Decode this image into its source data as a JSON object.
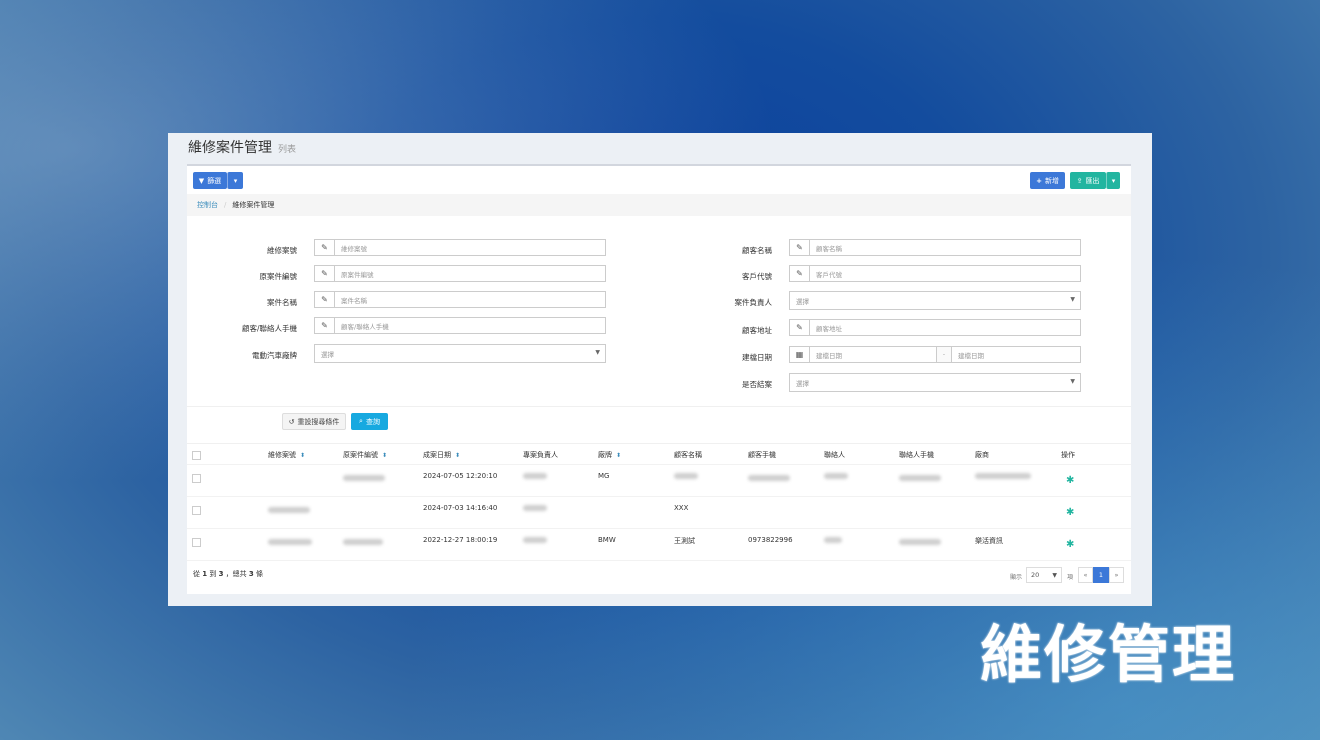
{
  "page": {
    "title": "維修案件管理",
    "subtitle": "列表"
  },
  "toolbar": {
    "filter_label": "篩選",
    "add_label": "新增",
    "export_label": "匯出"
  },
  "breadcrumb": {
    "home": "控制台",
    "current": "維修案件管理"
  },
  "form": {
    "left": [
      {
        "label": "維修案號",
        "placeholder": "維修案號",
        "icon": "pencil-icon"
      },
      {
        "label": "原案件編號",
        "placeholder": "原案件編號",
        "icon": "pencil-icon"
      },
      {
        "label": "案件名稱",
        "placeholder": "案件名稱",
        "icon": "pencil-icon"
      },
      {
        "label": "顧客/聯絡人手機",
        "placeholder": "顧客/聯絡人手機",
        "icon": "pencil-icon"
      },
      {
        "label": "電動汽車廠牌",
        "select": "選擇"
      }
    ],
    "right": [
      {
        "label": "顧客名稱",
        "placeholder": "顧客名稱",
        "icon": "pencil-icon"
      },
      {
        "label": "客戶代號",
        "placeholder": "客戶代號",
        "icon": "pencil-icon"
      },
      {
        "label": "案件負責人",
        "select": "選擇"
      },
      {
        "label": "顧客地址",
        "placeholder": "顧客地址",
        "icon": "pencil-icon"
      },
      {
        "label": "建檔日期",
        "date_from": "建檔日期",
        "date_sep": "-",
        "date_to": "建檔日期",
        "icon": "calendar-icon"
      },
      {
        "label": "是否結案",
        "select": "選擇"
      }
    ],
    "reset_label": "重設搜尋條件",
    "search_label": "查詢"
  },
  "table": {
    "headers": [
      "維修案號",
      "原案件編號",
      "成案日期",
      "專案負責人",
      "廠牌",
      "顧客名稱",
      "顧客手機",
      "聯絡人",
      "聯絡人手機",
      "廠商",
      "操作"
    ],
    "rows": [
      {
        "date": "2024-07-05 12:20:10",
        "brand": "MG",
        "customer": "",
        "phone": "",
        "vendor": ""
      },
      {
        "date": "2024-07-03 14:16:40",
        "brand": "",
        "customer": "XXX",
        "phone": "",
        "vendor": ""
      },
      {
        "date": "2022-12-27 18:00:19",
        "brand": "BMW",
        "customer": "王測試",
        "phone": "0973822996",
        "vendor": "樂活資訊"
      }
    ]
  },
  "footer": {
    "summary_prefix": "從",
    "from": "1",
    "to_word": "到",
    "to": "3",
    "total_prefix": "，總共",
    "total": "3",
    "total_suffix": "條",
    "show_label": "顯示",
    "page_size": "20",
    "page_size_suffix": "項",
    "prev": "«",
    "current_page": "1",
    "next": "»"
  },
  "banner": {
    "text": "維修管理"
  },
  "colors": {
    "primary": "#3c78d8",
    "success": "#22b5a0",
    "info": "#17a9e0"
  }
}
